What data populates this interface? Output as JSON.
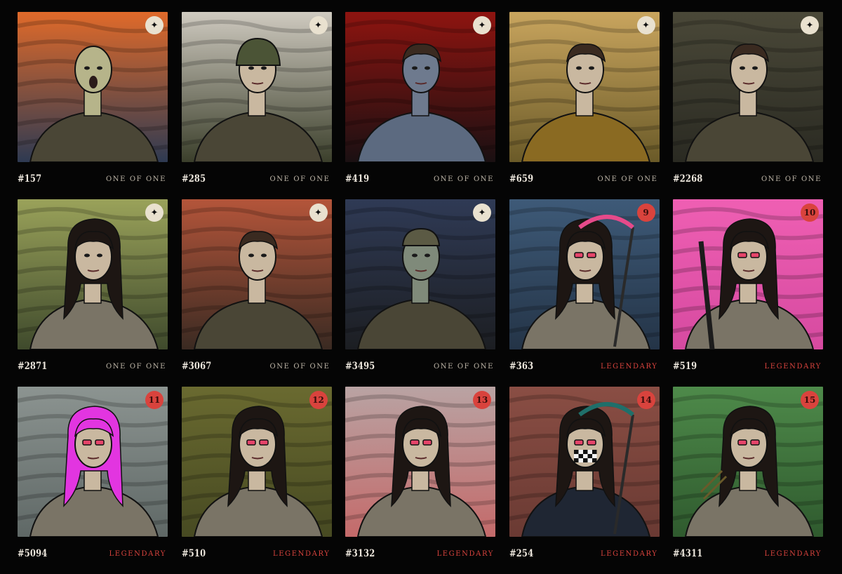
{
  "colors": {
    "page_background": "#050505",
    "number_text": "#ece6dc",
    "one_of_one_text": "#bdb5a7",
    "legendary_text": "#d9433d",
    "one_of_one_badge": "#e9e1cf",
    "legendary_badge": "#d9433d"
  },
  "badge_symbols": {
    "one_of_one": "✦"
  },
  "cards": [
    {
      "id": "#157",
      "rarity": "ONE OF ONE",
      "badge": "✦",
      "art": "scream-portrait",
      "bg": [
        "#e06a2a",
        "#2e3a52"
      ]
    },
    {
      "id": "#285",
      "rarity": "ONE OF ONE",
      "badge": "✦",
      "art": "soldier-portrait",
      "bg": [
        "#cfcac0",
        "#3b3f2b"
      ]
    },
    {
      "id": "#419",
      "rarity": "ONE OF ONE",
      "badge": "✦",
      "art": "vampire-portrait",
      "bg": [
        "#8e1410",
        "#1a1012"
      ]
    },
    {
      "id": "#659",
      "rarity": "ONE OF ONE",
      "badge": "✦",
      "art": "monk-portrait",
      "bg": [
        "#c9a55e",
        "#6a5a28"
      ]
    },
    {
      "id": "#2268",
      "rarity": "ONE OF ONE",
      "badge": "✦",
      "art": "hermit-portrait",
      "bg": [
        "#4a4838",
        "#2a2a22"
      ]
    },
    {
      "id": "#2871",
      "rarity": "ONE OF ONE",
      "badge": "✦",
      "art": "cloaked-woman-portrait",
      "bg": [
        "#9aa25a",
        "#3f4a2c"
      ]
    },
    {
      "id": "#3067",
      "rarity": "ONE OF ONE",
      "badge": "✦",
      "art": "woodsman-portrait",
      "bg": [
        "#b4553a",
        "#3a2a22"
      ]
    },
    {
      "id": "#3495",
      "rarity": "ONE OF ONE",
      "badge": "✦",
      "art": "vagrant-portrait",
      "bg": [
        "#2f3a55",
        "#1c1e22"
      ]
    },
    {
      "id": "#363",
      "rarity": "LEGENDARY",
      "badge": "9",
      "art": "hooded-scythe-portrait",
      "bg": [
        "#3e5a78",
        "#243447"
      ]
    },
    {
      "id": "#519",
      "rarity": "LEGENDARY",
      "badge": "10",
      "art": "rifle-woman-portrait",
      "bg": [
        "#ef5fb3",
        "#d64aa0"
      ]
    },
    {
      "id": "#5094",
      "rarity": "LEGENDARY",
      "badge": "11",
      "art": "pink-hair-portrait",
      "bg": [
        "#8c9491",
        "#5f6866"
      ]
    },
    {
      "id": "#510",
      "rarity": "LEGENDARY",
      "badge": "12",
      "art": "smoker-olive-portrait",
      "bg": [
        "#6a6a30",
        "#474a22"
      ]
    },
    {
      "id": "#3132",
      "rarity": "LEGENDARY",
      "badge": "13",
      "art": "axe-smoker-portrait",
      "bg": [
        "#b9a3a3",
        "#c46a6a"
      ]
    },
    {
      "id": "#254",
      "rarity": "LEGENDARY",
      "badge": "14",
      "art": "reaper-masked-portrait",
      "bg": [
        "#8a4e44",
        "#6a3a33"
      ]
    },
    {
      "id": "#4311",
      "rarity": "LEGENDARY",
      "badge": "15",
      "art": "archer-green-portrait",
      "bg": [
        "#4e8a4a",
        "#2f5a2e"
      ]
    }
  ]
}
